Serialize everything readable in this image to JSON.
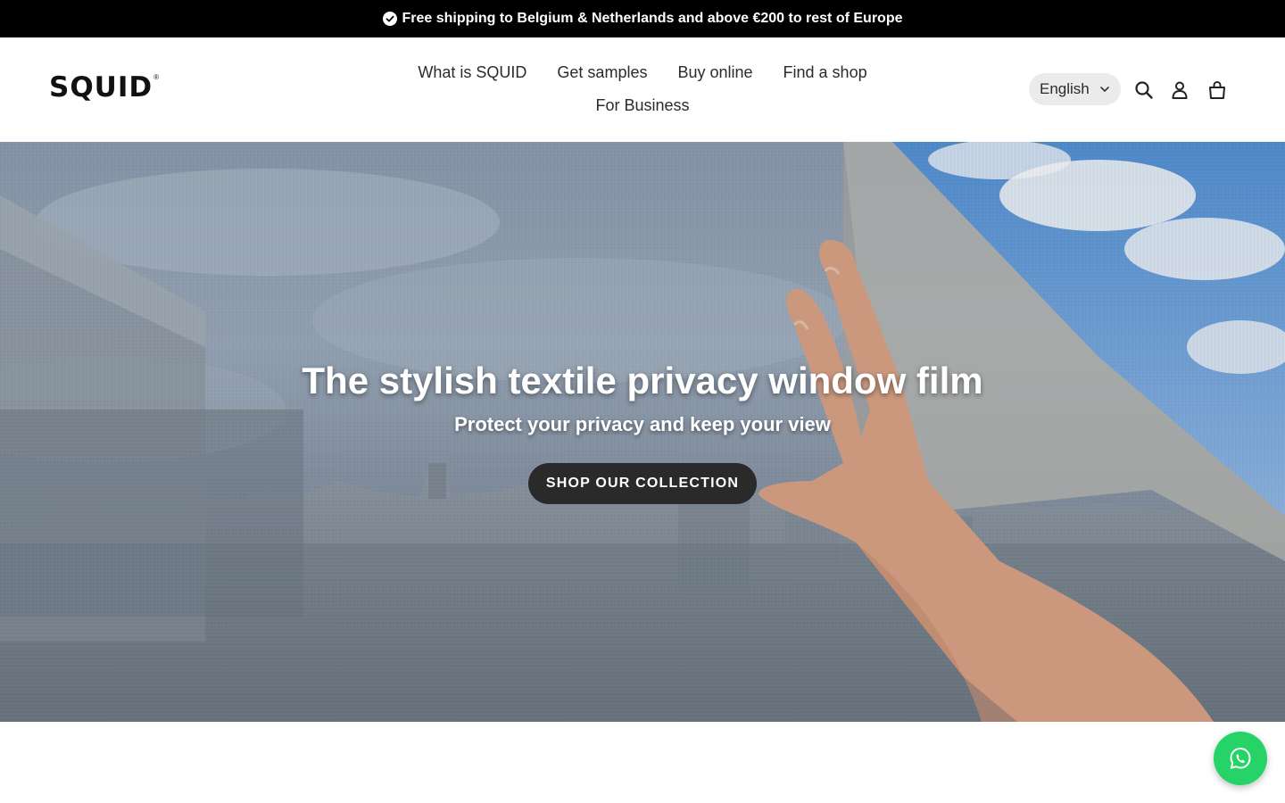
{
  "announcement": {
    "text": "Free shipping to Belgium & Netherlands and above €200 to rest of Europe",
    "icon": "check-circle-icon"
  },
  "header": {
    "logo": "SQUID",
    "logo_mark": "®",
    "nav": [
      {
        "label": "What is SQUID"
      },
      {
        "label": "Get samples"
      },
      {
        "label": "Buy online"
      },
      {
        "label": "Find a shop"
      },
      {
        "label": "For Business"
      }
    ],
    "language": {
      "selected": "English"
    },
    "icons": [
      "search-icon",
      "account-icon",
      "cart-icon"
    ]
  },
  "hero": {
    "title": "The stylish textile privacy window film",
    "subtitle": "Protect your privacy and keep your view",
    "button_label": "SHOP OUR COLLECTION"
  },
  "colors": {
    "announcement_bg": "#000000",
    "button_bg": "#2a2a2a",
    "whatsapp": "#25d366",
    "sky": "#4f8fd6"
  },
  "widgets": {
    "whatsapp": "whatsapp-icon"
  }
}
